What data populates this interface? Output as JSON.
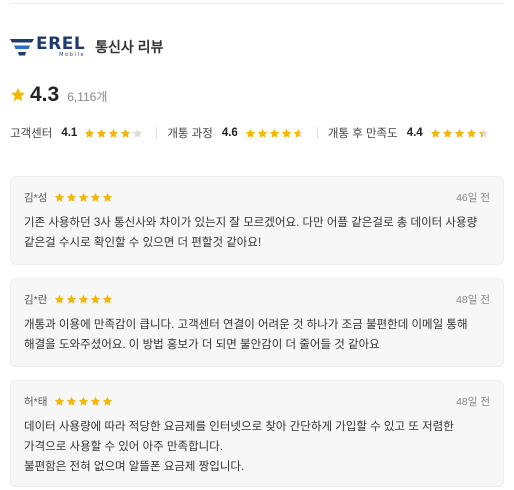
{
  "header": {
    "logo_word": "EREL",
    "logo_sub": "Mobile",
    "title": "통신사 리뷰"
  },
  "summary": {
    "average": "4.3",
    "count": "6,116개",
    "rating": 4.3
  },
  "categories": [
    {
      "label": "고객센터",
      "score": "4.1",
      "rating": 4.1
    },
    {
      "label": "개통 과정",
      "score": "4.6",
      "rating": 4.6
    },
    {
      "label": "개통 후 만족도",
      "score": "4.4",
      "rating": 4.4
    }
  ],
  "reviews": [
    {
      "name": "김*성",
      "rating": 5,
      "date": "46일 전",
      "text": "기존 사용하던 3사 통신사와 차이가 있는지 잘 모르겠어요. 다만 어플 같은걸로 총 데이터 사용량 같은걸 수시로 확인할 수 있으면 더 편할것 같아요!"
    },
    {
      "name": "김*란",
      "rating": 5,
      "date": "48일 전",
      "text": "개통과 이용에 만족감이 큽니다. 고객센터 연결이 어려운 것 하나가 조금 불편한데 이메일 통해 해결을 도와주셨어요. 이 방법 홍보가 더 되면 불안감이 더 줄어들 것 같아요"
    },
    {
      "name": "허*태",
      "rating": 5,
      "date": "48일 전",
      "text": "데이터 사용량에 따라 적당한 요금제를 인터넷으로 찾아 간단하게 가입할 수 있고 또 저렴한 가격으로 사용할 수 있어 아주 만족합니다.\n불편함은 전혀 없으며 알뜰폰 요금제 짱입니다."
    }
  ],
  "colors": {
    "star": "#F5B800",
    "star_empty": "#DDDDDD",
    "brand": "#1F3B6E"
  }
}
